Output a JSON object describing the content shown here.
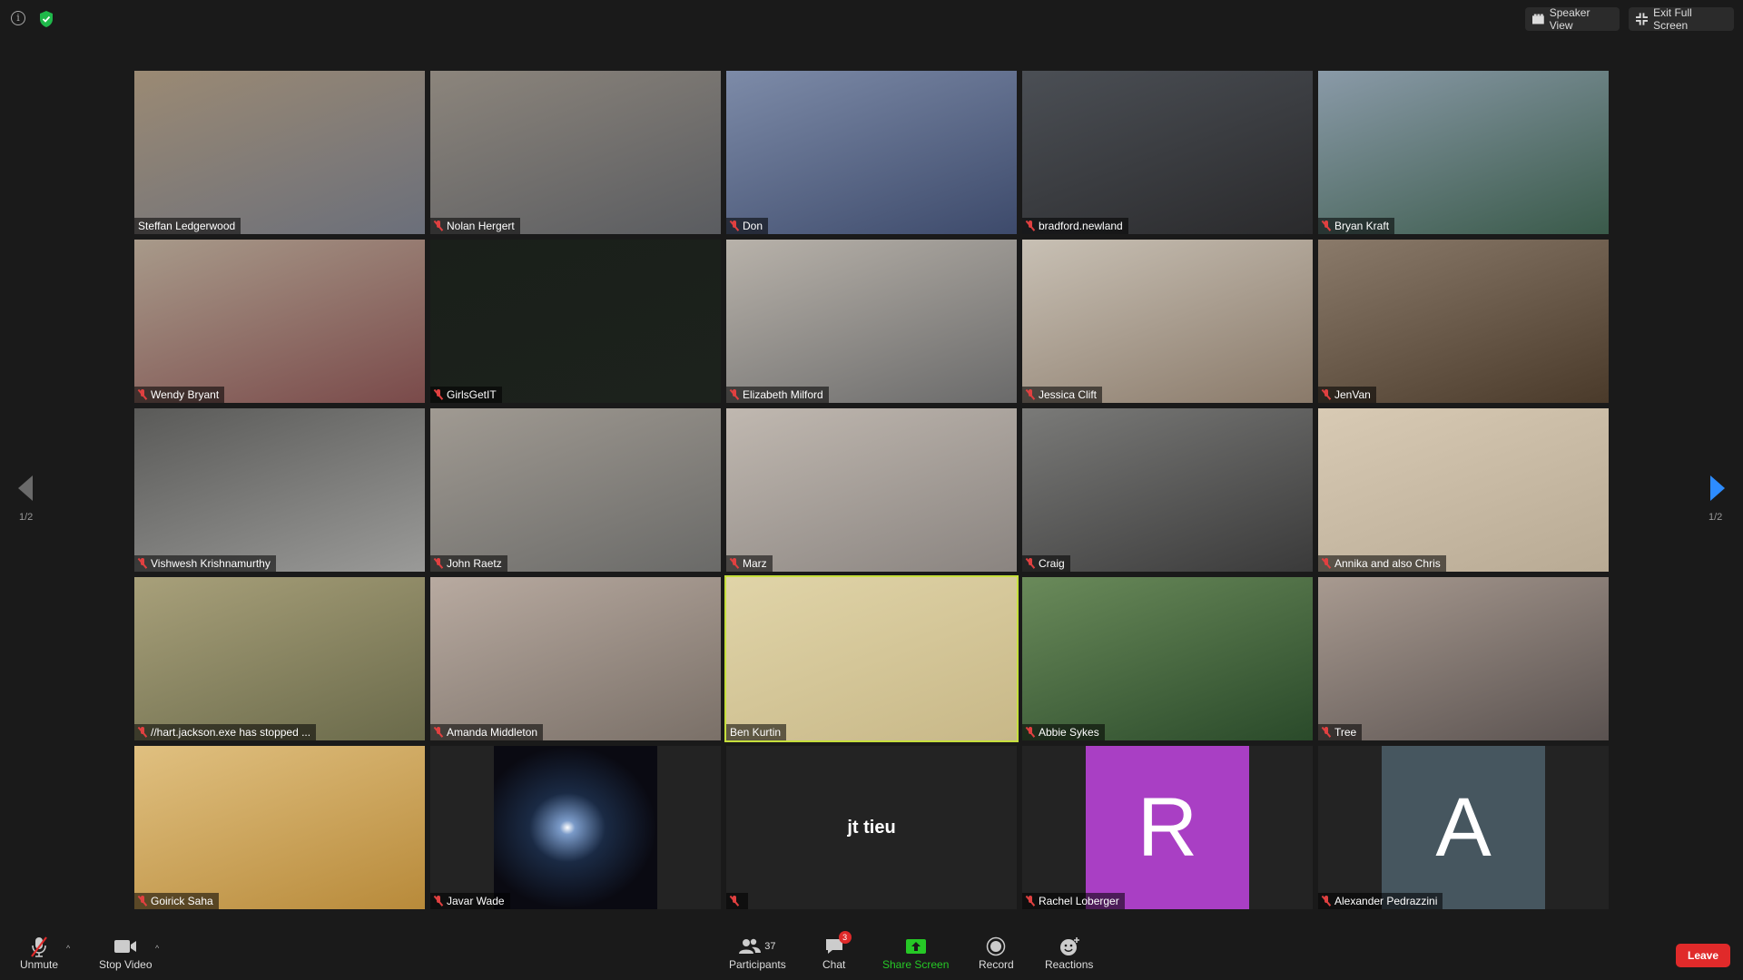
{
  "top_bar": {
    "speaker_view": "Speaker View",
    "exit_full_screen": "Exit Full Screen"
  },
  "pager": {
    "prev": "1/2",
    "next": "1/2"
  },
  "participants": [
    {
      "name": "Steffan Ledgerwood",
      "muted": false
    },
    {
      "name": "Nolan Hergert",
      "muted": true
    },
    {
      "name": "Don",
      "muted": true
    },
    {
      "name": "bradford.newland",
      "muted": true
    },
    {
      "name": "Bryan Kraft",
      "muted": true
    },
    {
      "name": "Wendy Bryant",
      "muted": true
    },
    {
      "name": "GirlsGetIT",
      "muted": true
    },
    {
      "name": "Elizabeth Milford",
      "muted": true
    },
    {
      "name": "Jessica Clift",
      "muted": true
    },
    {
      "name": "JenVan",
      "muted": true
    },
    {
      "name": "Vishwesh Krishnamurthy",
      "muted": true
    },
    {
      "name": "John Raetz",
      "muted": true
    },
    {
      "name": "Marz",
      "muted": true
    },
    {
      "name": "Craig",
      "muted": true
    },
    {
      "name": "Annika and also Chris",
      "muted": true
    },
    {
      "name": "//hart.jackson.exe has stopped ...",
      "muted": true
    },
    {
      "name": "Amanda Middleton",
      "muted": true
    },
    {
      "name": "Ben Kurtin",
      "muted": false,
      "active_speaker": true
    },
    {
      "name": "Abbie Sykes",
      "muted": true
    },
    {
      "name": "Tree",
      "muted": true
    },
    {
      "name": "Goirick Saha",
      "muted": true
    },
    {
      "name": "Javar Wade",
      "muted": true
    },
    {
      "name": "",
      "muted": true,
      "center_text": "jt tieu"
    },
    {
      "name": "Rachel Loberger",
      "muted": true,
      "avatar_letter": "R",
      "avatar_color": "#a93fc4"
    },
    {
      "name": "Alexander Pedrazzini",
      "muted": true,
      "avatar_letter": "A",
      "avatar_color": "#46565f"
    }
  ],
  "toolbar": {
    "unmute": "Unmute",
    "stop_video": "Stop Video",
    "participants": "Participants",
    "participants_count": "37",
    "chat": "Chat",
    "chat_badge": "3",
    "share_screen": "Share Screen",
    "record": "Record",
    "reactions": "Reactions",
    "leave": "Leave"
  },
  "colors": {
    "background": "#1a1a1a",
    "active_speaker": "#c6df3c",
    "share_green": "#26c826",
    "leave_red": "#e02a2a",
    "pager_blue": "#2d8cff"
  }
}
